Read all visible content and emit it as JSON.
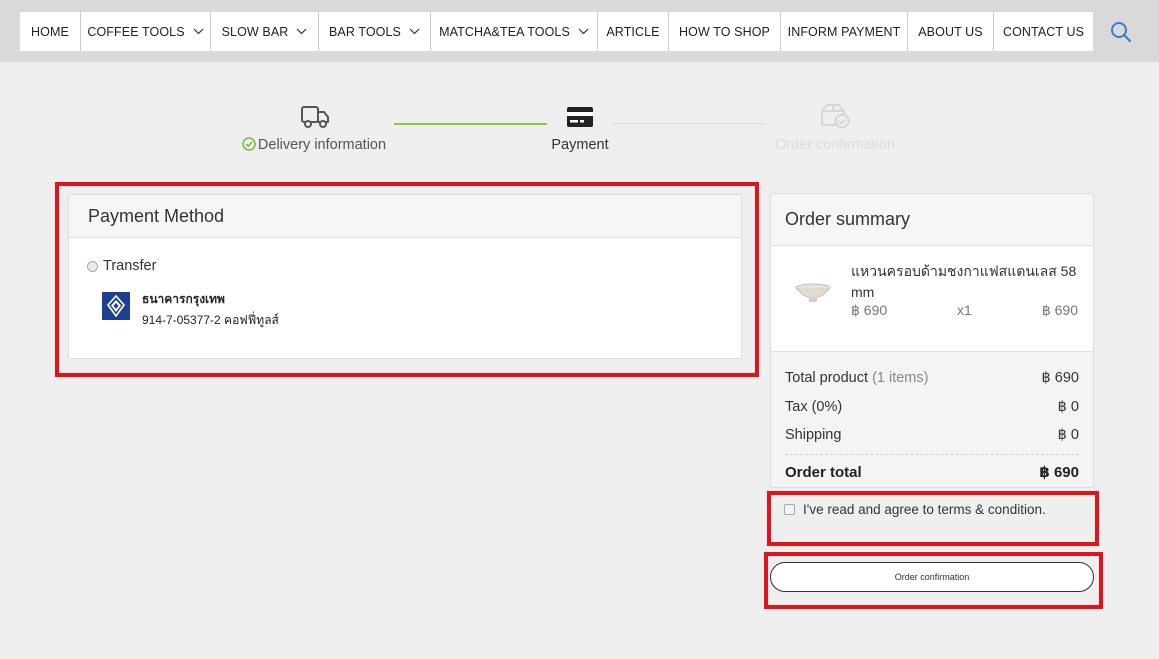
{
  "nav": {
    "items": [
      {
        "label": "HOME",
        "dropdown": false
      },
      {
        "label": "COFFEE TOOLS",
        "dropdown": true
      },
      {
        "label": "SLOW BAR",
        "dropdown": true
      },
      {
        "label": "BAR TOOLS",
        "dropdown": true
      },
      {
        "label": "MATCHA&TEA TOOLS",
        "dropdown": true
      },
      {
        "label": "ARTICLE",
        "dropdown": false
      },
      {
        "label": "HOW TO SHOP",
        "dropdown": false
      },
      {
        "label": "INFORM PAYMENT",
        "dropdown": false
      },
      {
        "label": "ABOUT US",
        "dropdown": false
      },
      {
        "label": "CONTACT US",
        "dropdown": false
      }
    ],
    "search_icon": "search-icon"
  },
  "stepper": {
    "steps": [
      {
        "label": "Delivery information",
        "state": "done",
        "icon": "truck-icon"
      },
      {
        "label": "Payment",
        "state": "current",
        "icon": "credit-card-icon"
      },
      {
        "label": "Order confirmation",
        "state": "pending",
        "icon": "box-check-icon"
      }
    ]
  },
  "payment": {
    "title": "Payment Method",
    "option_label": "Transfer",
    "bank_name": "ธนาคารกรุงเทพ",
    "account": "914-7-05377-2 คอฟฟี่ทูลส์"
  },
  "summary": {
    "title": "Order summary",
    "item": {
      "name": "แหวนครอบด้ามชงกาแฟสแตนเลส 58 mm",
      "unit_price": "฿ 690",
      "qty": "x1",
      "amount": "฿ 690"
    },
    "total_product_label": "Total product",
    "total_product_count": "(1 items)",
    "total_product_value": "฿ 690",
    "tax_label": "Tax (0%)",
    "tax_value": "฿ 0",
    "shipping_label": "Shipping",
    "shipping_value": "฿ 0",
    "order_total_label": "Order total",
    "order_total_value": "฿ 690"
  },
  "terms_label": "I've read and agree to terms & condition.",
  "confirm_button": "Order confirmation",
  "colors": {
    "highlight": "#e3121b",
    "progress_done": "#8dc63f",
    "check_green": "#6cbf3a",
    "bank_blue": "#1e3f8f"
  }
}
